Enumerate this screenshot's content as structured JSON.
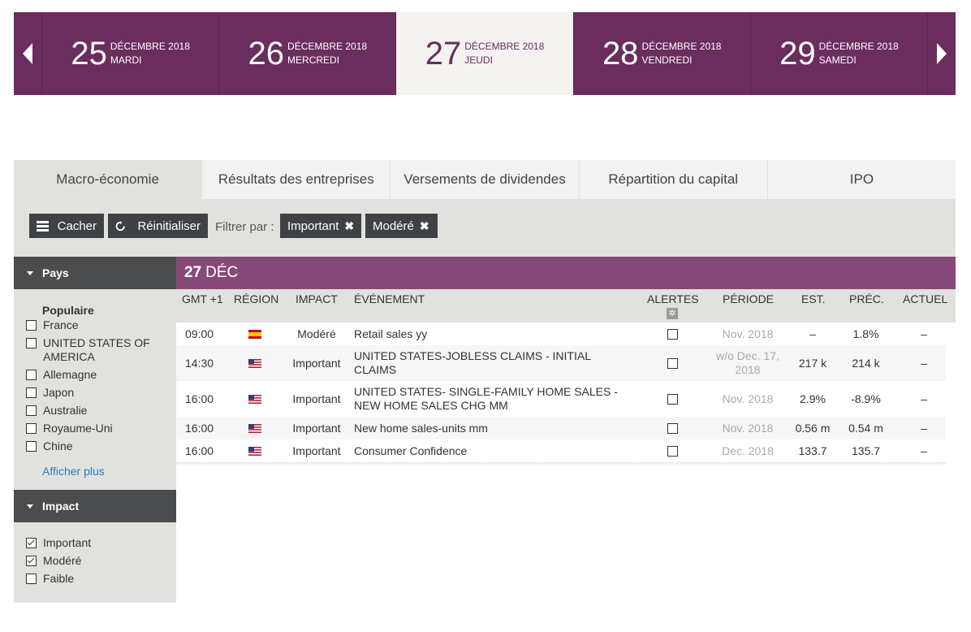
{
  "date_strip": {
    "dates": [
      {
        "day": "25",
        "month": "DÉCEMBRE 2018",
        "weekday": "MARDI",
        "active": false
      },
      {
        "day": "26",
        "month": "DÉCEMBRE 2018",
        "weekday": "MERCREDI",
        "active": false
      },
      {
        "day": "27",
        "month": "DÉCEMBRE 2018",
        "weekday": "JEUDI",
        "active": true
      },
      {
        "day": "28",
        "month": "DÉCEMBRE 2018",
        "weekday": "VENDREDI",
        "active": false
      },
      {
        "day": "29",
        "month": "DÉCEMBRE 2018",
        "weekday": "SAMEDI",
        "active": false
      }
    ]
  },
  "tabs": [
    {
      "label": "Macro-économie",
      "active": true
    },
    {
      "label": "Résultats des entreprises",
      "active": false
    },
    {
      "label": "Versements de dividendes",
      "active": false
    },
    {
      "label": "Répartition du capital",
      "active": false
    },
    {
      "label": "IPO",
      "active": false
    }
  ],
  "filterbar": {
    "hide_label": "Cacher",
    "reset_label": "Réinitialiser",
    "filter_by_label": "Filtrer par :",
    "chips": [
      "Important",
      "Modéré"
    ]
  },
  "sidebar": {
    "country_header": "Pays",
    "popular_label": "Populaire",
    "countries": [
      "France",
      "UNITED STATES OF AMERICA",
      "Allemagne",
      "Japon",
      "Australie",
      "Royaume-Uni",
      "Chine"
    ],
    "show_more": "Afficher plus",
    "impact_header": "Impact",
    "impacts": [
      {
        "label": "Important",
        "checked": true
      },
      {
        "label": "Modéré",
        "checked": true
      },
      {
        "label": "Faible",
        "checked": false
      }
    ]
  },
  "table": {
    "day_number": "27",
    "day_month": "DÉC",
    "headers": {
      "time": "GMT +1",
      "region": "RÉGION",
      "impact": "IMPACT",
      "event": "ÉVÉNEMENT",
      "alerts": "ALERTES",
      "period": "PÉRIODE",
      "est": "EST.",
      "prev": "PRÉC.",
      "actual": "ACTUEL"
    },
    "rows": [
      {
        "time": "09:00",
        "flag": "spain-flag",
        "impact": "Modéré",
        "event": "Retail sales yy",
        "period": "Nov. 2018",
        "est": "–",
        "prev": "1.8%",
        "actual": "–"
      },
      {
        "time": "14:30",
        "flag": "us-flag",
        "impact": "Important",
        "event": "UNITED STATES-JOBLESS CLAIMS - INITIAL CLAIMS",
        "period": "w/o Dec. 17, 2018",
        "est": "217 k",
        "prev": "214 k",
        "actual": "–"
      },
      {
        "time": "16:00",
        "flag": "us-flag",
        "impact": "Important",
        "event": "UNITED STATES- SINGLE-FAMILY HOME SALES - NEW HOME SALES CHG MM",
        "period": "Nov. 2018",
        "est": "2.9%",
        "prev": "-8.9%",
        "actual": "–"
      },
      {
        "time": "16:00",
        "flag": "us-flag",
        "impact": "Important",
        "event": "New home sales-units mm",
        "period": "Nov. 2018",
        "est": "0.56 m",
        "prev": "0.54 m",
        "actual": "–"
      },
      {
        "time": "16:00",
        "flag": "us-flag",
        "impact": "Important",
        "event": "Consumer Confidence",
        "period": "Dec. 2018",
        "est": "133.7",
        "prev": "135.7",
        "actual": "–"
      }
    ]
  },
  "colors": {
    "brand_purple": "#6b2c5e",
    "day_bar": "#874a78",
    "dark_button": "#3f4244",
    "panel_gray": "#e1e2de",
    "link_blue": "#2b7bc0"
  }
}
